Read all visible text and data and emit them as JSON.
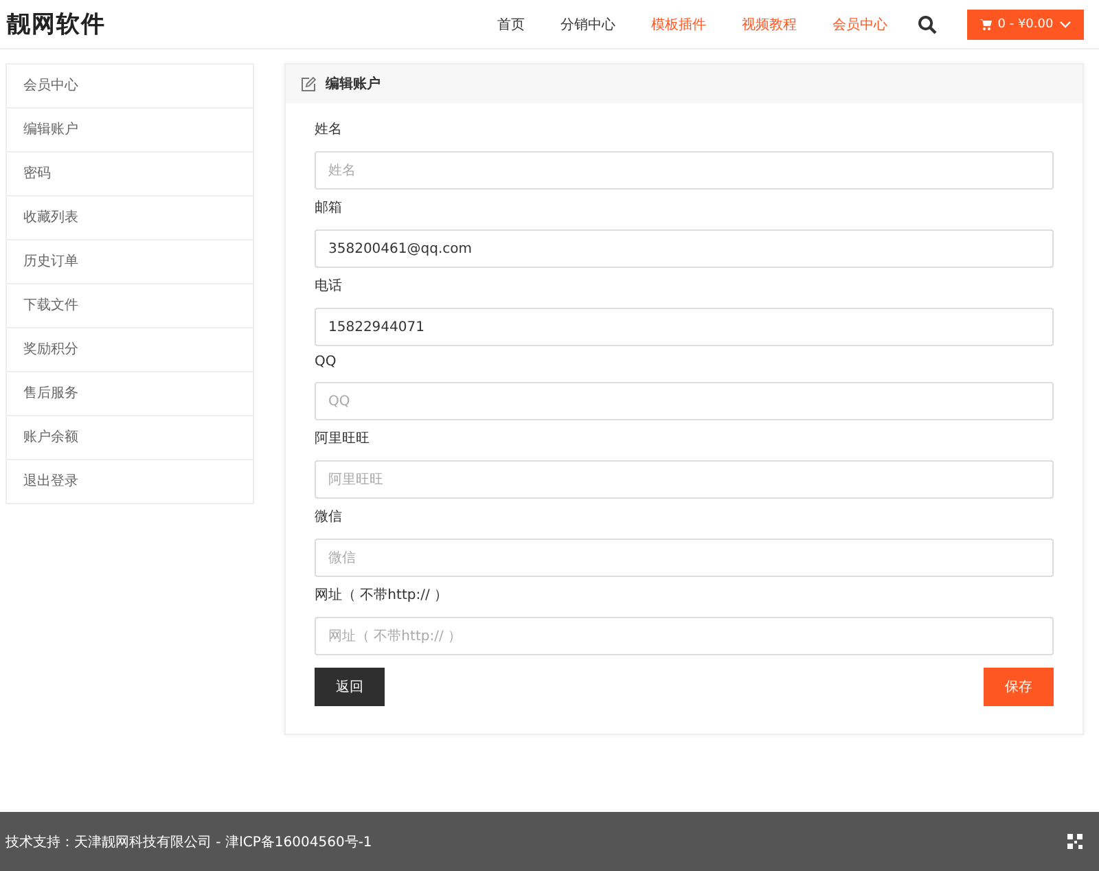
{
  "header": {
    "logo": "靓网软件",
    "nav": [
      {
        "label": "首页",
        "color": "#333333"
      },
      {
        "label": "分销中心",
        "color": "#333333"
      },
      {
        "label": "模板插件",
        "color": "#ff5722"
      },
      {
        "label": "视频教程",
        "color": "#ff5722"
      },
      {
        "label": "会员中心",
        "color": "#ff5722"
      }
    ],
    "cart": "0 - ¥0.00"
  },
  "sidebar": {
    "items": [
      "会员中心",
      "编辑账户",
      "密码",
      "收藏列表",
      "历史订单",
      "下载文件",
      "奖励积分",
      "售后服务",
      "账户余额",
      "退出登录"
    ]
  },
  "panel": {
    "title": "编辑账户",
    "fields": [
      {
        "label": "姓名",
        "placeholder": "姓名"
      },
      {
        "label": "邮箱",
        "value": "358200461@qq.com"
      },
      {
        "label": "电话",
        "value": "15822944071"
      },
      {
        "label": "QQ",
        "placeholder": "QQ"
      },
      {
        "label": "阿里旺旺",
        "placeholder": "阿里旺旺"
      },
      {
        "label": "微信",
        "placeholder": "微信"
      },
      {
        "label": "网址（ 不带http:// ）",
        "placeholder": "网址（ 不带http:// ）"
      }
    ],
    "buttons": [
      {
        "label": "返回",
        "kind": "back"
      },
      {
        "label": "保存",
        "kind": "save"
      }
    ]
  },
  "footer": {
    "text": "技术支持：天津靓网科技有限公司 - 津ICP备16004560号-1"
  }
}
